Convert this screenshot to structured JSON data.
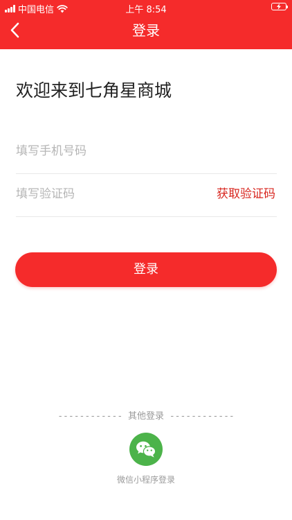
{
  "status_bar": {
    "carrier": "中国电信",
    "time": "上午 8:54"
  },
  "header": {
    "title": "登录"
  },
  "welcome_text": "欢迎来到七角星商城",
  "form": {
    "phone_placeholder": "填写手机号码",
    "code_placeholder": "填写验证码",
    "get_code_label": "获取验证码"
  },
  "login_button_label": "登录",
  "other_login": {
    "divider_left": "------------ ",
    "label": "其他登录",
    "divider_right": " ------------",
    "wechat_label": "微信小程序登录"
  },
  "colors": {
    "brand_red": "#f52b2b",
    "code_link_red": "#d8261f",
    "wechat_green": "#4cb34a"
  },
  "icons": [
    "signal-icon",
    "wifi-icon",
    "battery-icon",
    "back-arrow-icon",
    "wechat-icon"
  ]
}
